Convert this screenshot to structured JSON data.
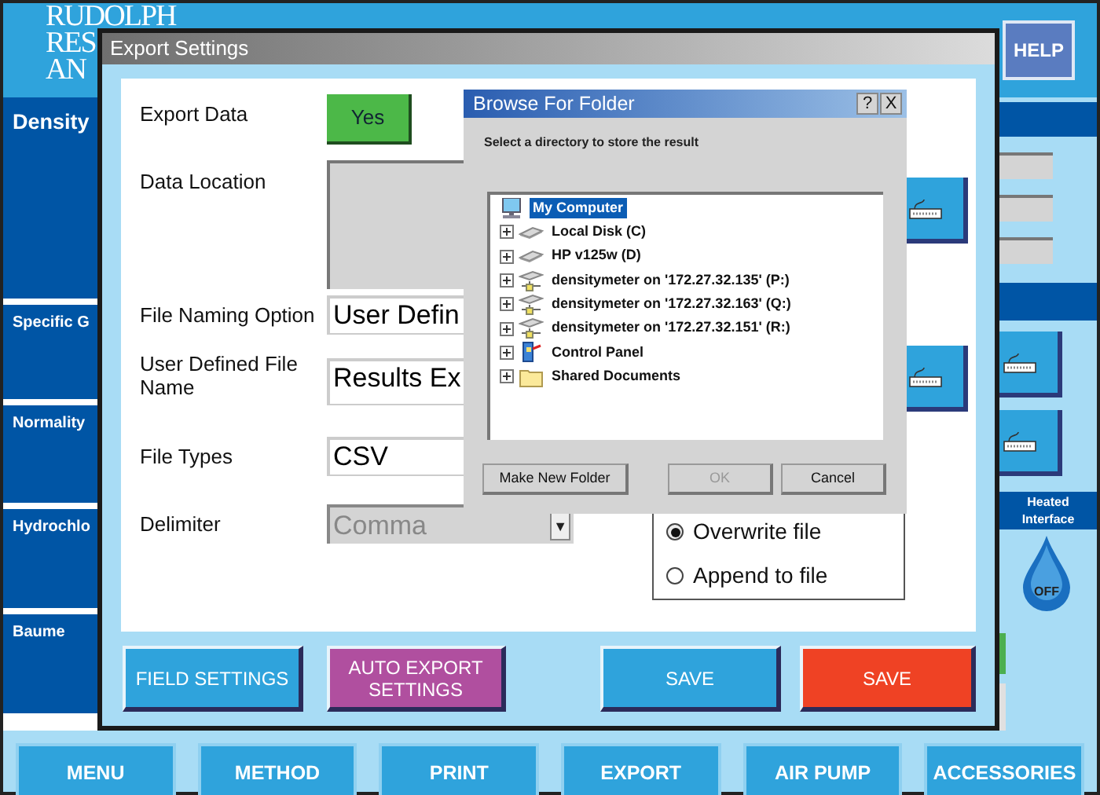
{
  "logo": [
    "RUDOLPH",
    "RES",
    "AN"
  ],
  "help_button": "HELP",
  "sidebar": {
    "items": [
      "Density",
      "Specific G",
      "Normality",
      "Hydrochlo",
      "Baume"
    ]
  },
  "heater": {
    "label": "Heated Interface",
    "on": false,
    "status": "OFF"
  },
  "nav": [
    "MENU",
    "METHOD",
    "PRINT",
    "EXPORT",
    "AIR PUMP",
    "ACCESSORIES"
  ],
  "export_dialog": {
    "title": "Export Settings",
    "fields": [
      {
        "label": "Export Data",
        "kind": "toggle",
        "value": "Yes",
        "on": true
      },
      {
        "label": "Data Location",
        "kind": "area",
        "keyboard": true
      },
      {
        "label": "File Naming Option",
        "kind": "text",
        "value": "User Defin"
      },
      {
        "label": "User Defined File Name",
        "kind": "text",
        "value": "Results Ex",
        "keyboard": true
      },
      {
        "label": "File Types",
        "kind": "text",
        "value": "CSV"
      },
      {
        "label": "Delimiter",
        "kind": "dropdown",
        "value": "Comma",
        "arrow": "▼",
        "disabled": true
      }
    ],
    "write_mode": [
      {
        "label": "Overwrite file",
        "selected": true
      },
      {
        "label": "Append to file",
        "selected": false
      }
    ],
    "buttons": [
      {
        "label": "FIELD SETTINGS",
        "color": "#2fa3dc"
      },
      {
        "label": "AUTO EXPORT SETTINGS",
        "color": "#b04f9f"
      },
      {
        "label": "SAVE",
        "color": "#2fa3dc"
      },
      {
        "label": "SAVE",
        "color": "#ef4224"
      }
    ]
  },
  "browse_dialog": {
    "title": "Browse For Folder",
    "help": "?",
    "close": "X",
    "instruction": "Select a directory to store the result",
    "tree": {
      "label": "My Computer",
      "kind": "computer",
      "selected": true,
      "children": [
        {
          "label": "Local Disk (C)",
          "kind": "disk",
          "selected": false,
          "expanded": false
        },
        {
          "label": "HP v125w (D)",
          "kind": "disk",
          "selected": false,
          "expanded": false
        },
        {
          "label": "densitymeter on '172.27.32.135' (P:)",
          "kind": "network",
          "selected": false,
          "expanded": false
        },
        {
          "label": "densitymeter on '172.27.32.163' (Q:)",
          "kind": "network",
          "selected": false,
          "expanded": false
        },
        {
          "label": "densitymeter on '172.27.32.151' (R:)",
          "kind": "network",
          "selected": false,
          "expanded": false
        },
        {
          "label": "Control Panel",
          "kind": "panel",
          "selected": false,
          "expanded": false
        },
        {
          "label": "Shared Documents",
          "kind": "folder",
          "selected": false,
          "expanded": false
        }
      ]
    },
    "buttons": [
      {
        "label": "Make New Folder",
        "disabled": false
      },
      {
        "label": "OK",
        "disabled": true
      },
      {
        "label": "Cancel",
        "disabled": false
      }
    ]
  }
}
